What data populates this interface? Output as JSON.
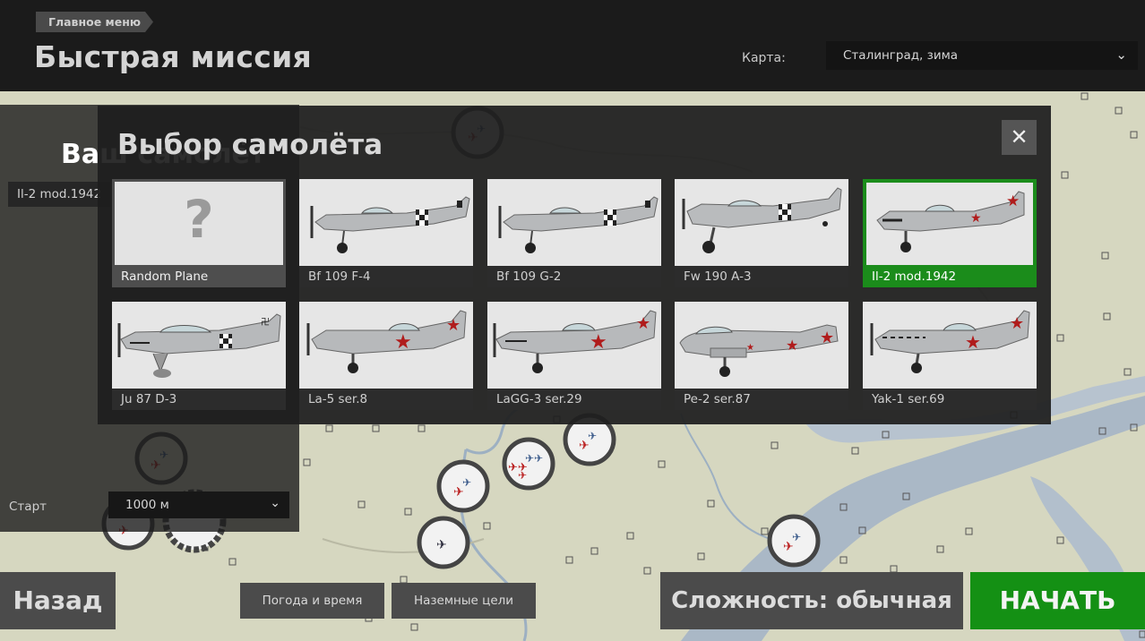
{
  "header": {
    "breadcrumb": "Главное меню",
    "title": "Быстрая миссия",
    "map_label": "Карта:",
    "map_value": "Сталинград, зима"
  },
  "side_panel": {
    "title": "Ваш самолёт",
    "selected_plane": "Il-2 mod.1942",
    "start_label": "Старт",
    "start_altitude": "1000 м"
  },
  "dialog": {
    "title": "Выбор самолёта",
    "close_icon": "close-icon",
    "planes": [
      {
        "name": "Random Plane",
        "faction": "none",
        "selected": false
      },
      {
        "name": "Bf 109 F-4",
        "faction": "german",
        "selected": false
      },
      {
        "name": "Bf 109 G-2",
        "faction": "german",
        "selected": false
      },
      {
        "name": "Fw 190 A-3",
        "faction": "german",
        "selected": false
      },
      {
        "name": "Il-2 mod.1942",
        "faction": "soviet",
        "selected": true
      },
      {
        "name": "Ju 87 D-3",
        "faction": "german",
        "selected": false
      },
      {
        "name": "La-5 ser.8",
        "faction": "soviet",
        "selected": false
      },
      {
        "name": "LaGG-3 ser.29",
        "faction": "soviet",
        "selected": false
      },
      {
        "name": "Pe-2 ser.87",
        "faction": "soviet",
        "selected": false
      },
      {
        "name": "Yak-1 ser.69",
        "faction": "soviet",
        "selected": false
      }
    ]
  },
  "bottom": {
    "back": "Назад",
    "weather": "Погода и время",
    "ground_targets": "Наземные цели",
    "difficulty": "Сложность: обычная",
    "start": "НАЧАТЬ"
  },
  "colors": {
    "accent_green": "#149014",
    "selected_green": "#1b8c1b",
    "map_bg": "#d8d9c2",
    "river": "#a9b8c7"
  }
}
